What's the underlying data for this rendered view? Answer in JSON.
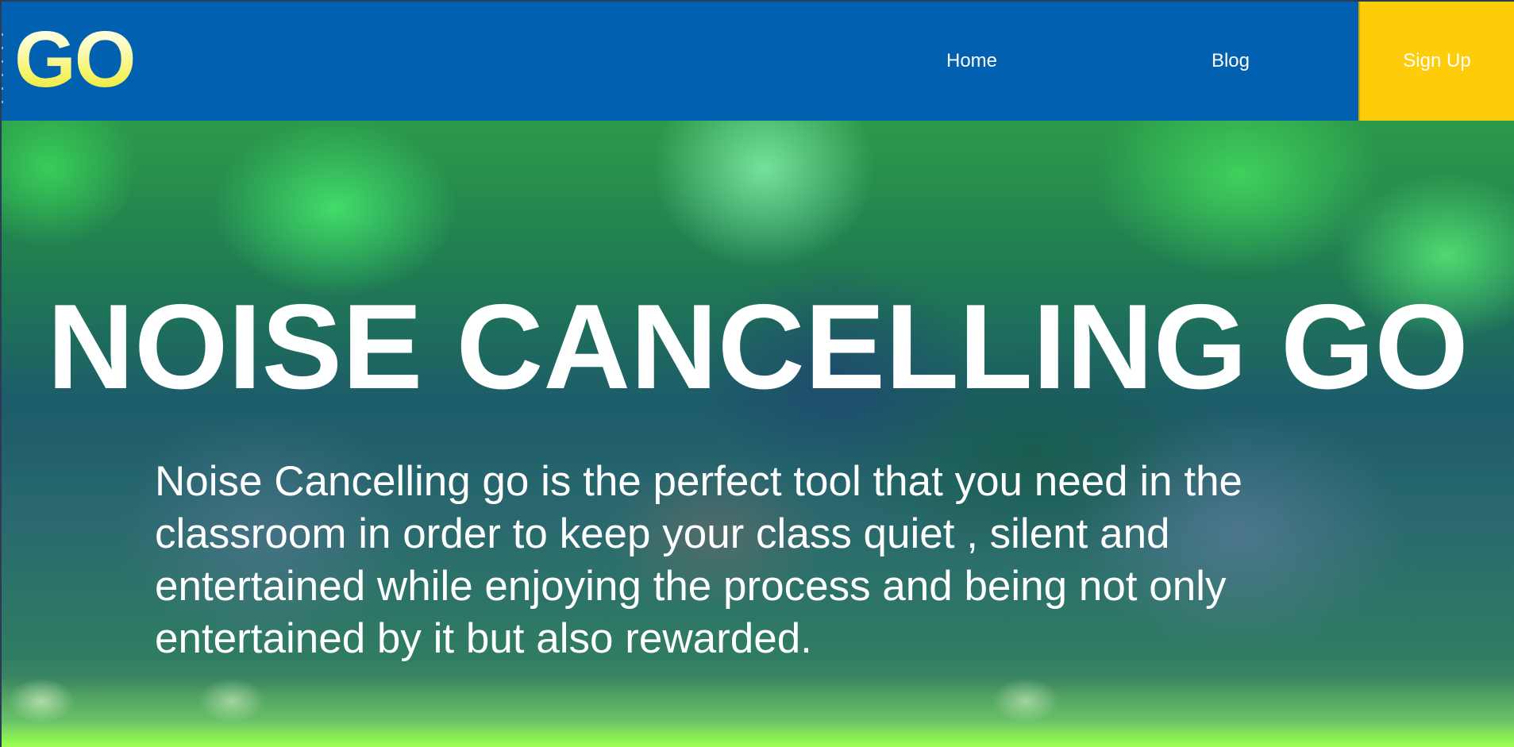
{
  "navbar": {
    "logo_text": "GO",
    "links": [
      {
        "label": "Home"
      },
      {
        "label": "Blog"
      }
    ],
    "signup_label": "Sign Up"
  },
  "hero": {
    "title": "NOISE CANCELLING GO",
    "description": "Noise Cancelling go is the perfect tool that you need in the classroom in order to keep your class quiet , silent and entertained while enjoying the process and being not only entertained by it but also rewarded."
  },
  "colors": {
    "navbar_bg": "#0260b0",
    "signup_bg": "#ffcc09",
    "logo_yellow": "#f3f35a",
    "text": "#ffffff"
  }
}
